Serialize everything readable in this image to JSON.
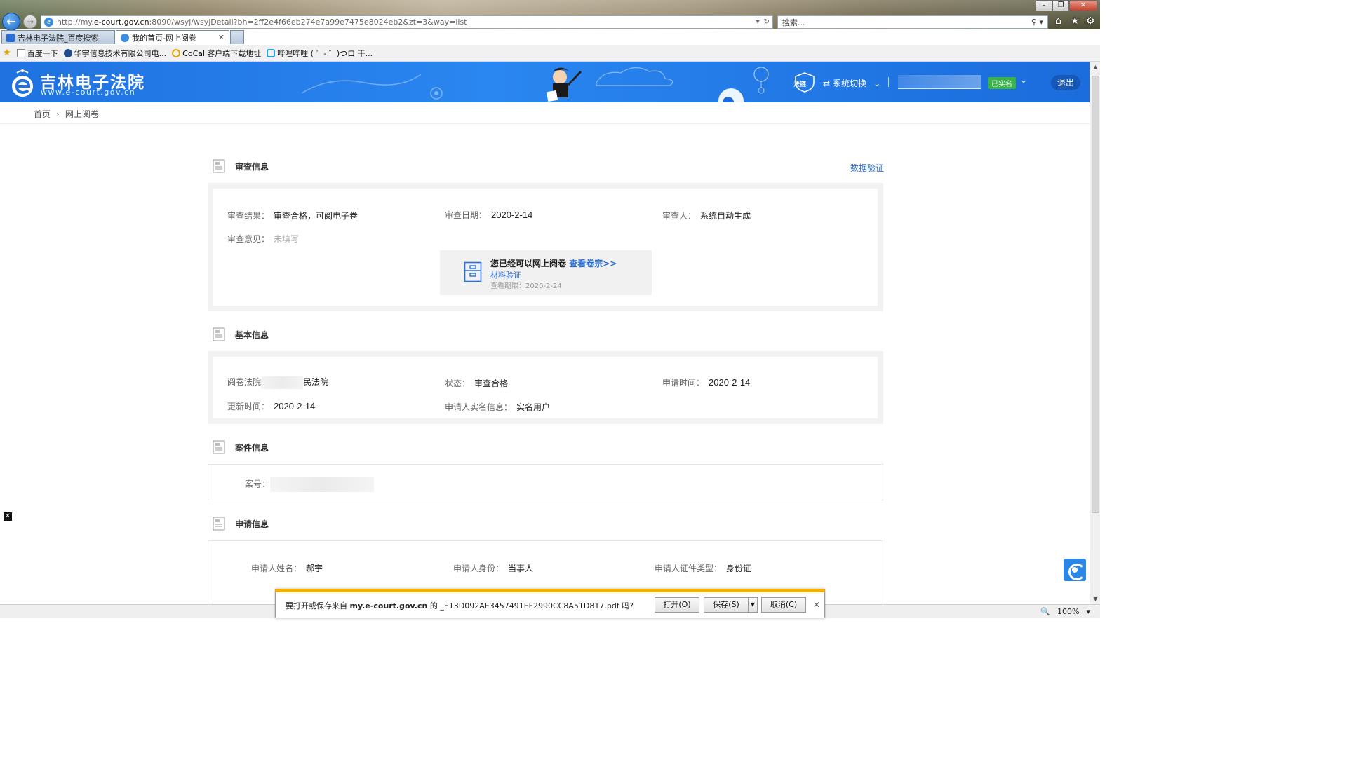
{
  "browser": {
    "url_prefix": "http://my.",
    "url_host": "e-court.gov.cn",
    "url_rest": ":8090/wsyj/wsyjDetail?bh=2ff2e4f66eb274e7a99e7475e8024eb2&zt=3&way=list",
    "search_placeholder": "搜索...",
    "tabs": [
      {
        "label": "吉林电子法院_百度搜索"
      },
      {
        "label": "我的首页-网上阅卷"
      }
    ],
    "favorites": [
      {
        "label": "百度一下"
      },
      {
        "label": "华宇信息技术有限公司电..."
      },
      {
        "label": "CoCall客户端下载地址"
      },
      {
        "label": "哔哩哔哩 ( ゜- ゜)つロ 干..."
      }
    ],
    "zoom": "100%"
  },
  "header": {
    "site_title": "吉林电子法院",
    "site_url": "www.e-court.gov.cn",
    "badge_label": "法链",
    "system_switch": "系统切换",
    "realname_badge": "已实名",
    "logout": "退出"
  },
  "breadcrumb": {
    "home": "首页",
    "current": "网上阅卷"
  },
  "review": {
    "section_title": "审查信息",
    "verify_link": "数据验证",
    "result_label": "审查结果：",
    "result_value": "审查合格，可阅电子卷",
    "date_label": "审查日期：",
    "date_value": "2020-2-14",
    "reviewer_label": "审查人：",
    "reviewer_value": "系统自动生成",
    "opinion_label": "审查意见：",
    "opinion_value": "未填写",
    "notice_text": "您已经可以网上阅卷",
    "notice_link": "查看卷宗>>",
    "notice_material": "材料验证",
    "notice_deadline": "查看期限：2020-2-24"
  },
  "basic": {
    "section_title": "基本信息",
    "court_label": "阅卷法院",
    "court_value_suffix": "民法院",
    "status_label": "状态：",
    "status_value": "审查合格",
    "apply_time_label": "申请时间：",
    "apply_time_value": "2020-2-14",
    "update_time_label": "更新时间：",
    "update_time_value": "2020-2-14",
    "realname_label": "申请人实名信息：",
    "realname_value": "实名用户"
  },
  "case": {
    "section_title": "案件信息",
    "case_no_label": "案号："
  },
  "applicant": {
    "section_title": "申请信息",
    "name_label": "申请人姓名：",
    "name_value": "郝宇",
    "identity_label": "申请人身份：",
    "identity_value": "当事人",
    "id_type_label": "申请人证件类型：",
    "id_type_value": "身份证"
  },
  "download": {
    "prompt_prefix": "要打开或保存来自 ",
    "host": "my.e-court.gov.cn",
    "prompt_mid": " 的 _E13D092AE3457491EF2990CC8A51D817.pdf 吗?",
    "open": "打开(O)",
    "save": "保存(S)",
    "cancel": "取消(C)"
  }
}
